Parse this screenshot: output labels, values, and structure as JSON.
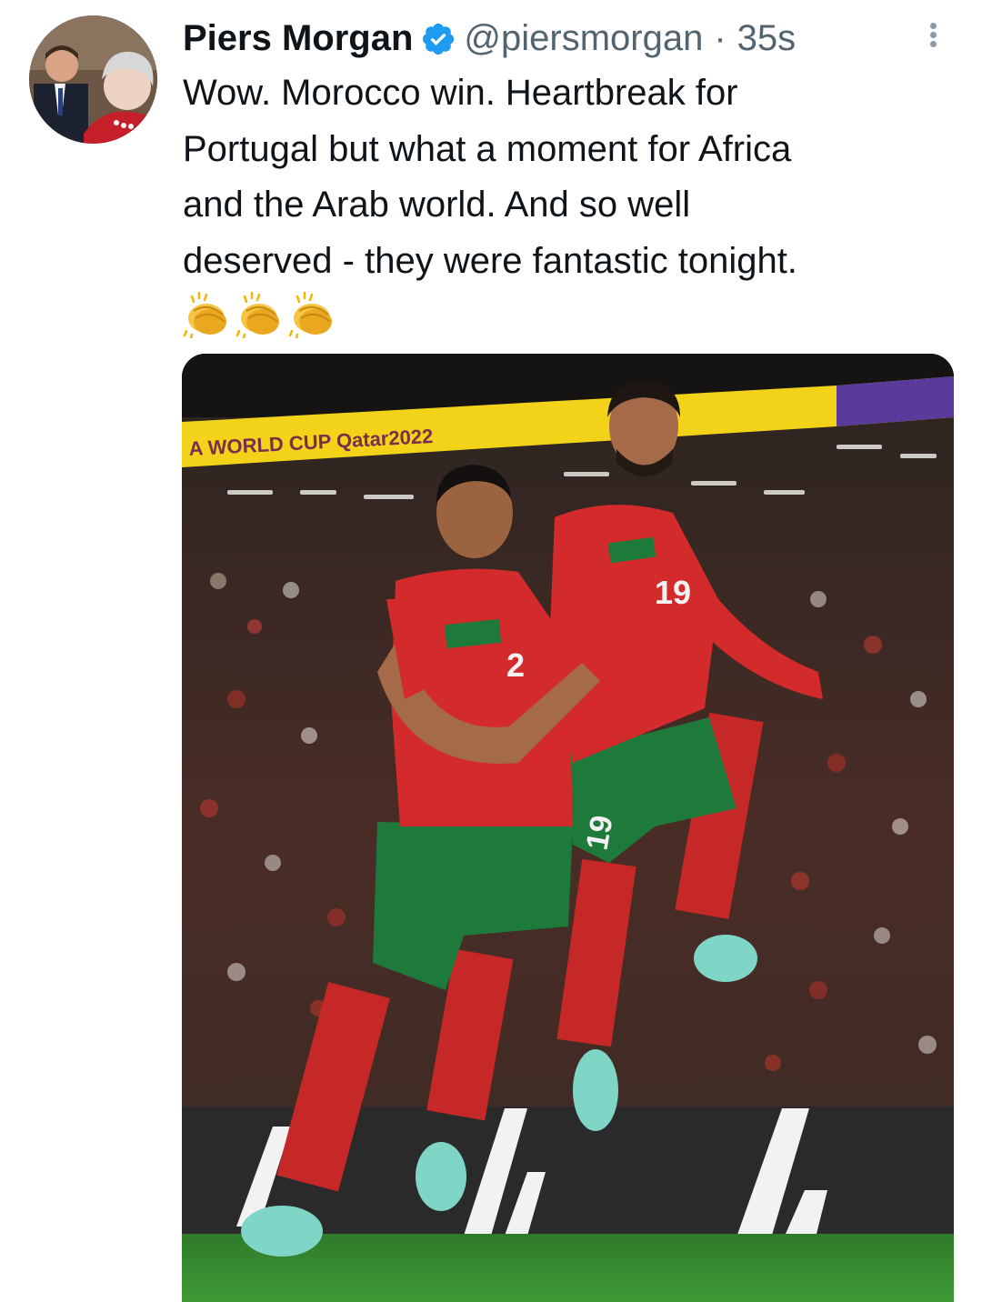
{
  "tweet": {
    "author_name": "Piers Morgan",
    "handle": "@piersmorgan",
    "separator": "·",
    "time": "35s",
    "text_lines": [
      "Wow. Morocco win. Heartbreak for",
      "Portugal but what a moment for Africa",
      "and the Arab world. And so well",
      "deserved - they were fantastic tonight."
    ],
    "emojis": [
      "clapping-hands",
      "clapping-hands",
      "clapping-hands"
    ]
  },
  "media": {
    "banner_text": "A WORLD CUP Qatar2022",
    "player_numbers": [
      "19",
      "2",
      "19"
    ]
  },
  "colors": {
    "verified": "#1d9bf0",
    "secondary_text": "#536471",
    "jersey_red": "#d32b2b",
    "jersey_green": "#1e7a3a",
    "banner_yellow": "#f2d31a"
  }
}
